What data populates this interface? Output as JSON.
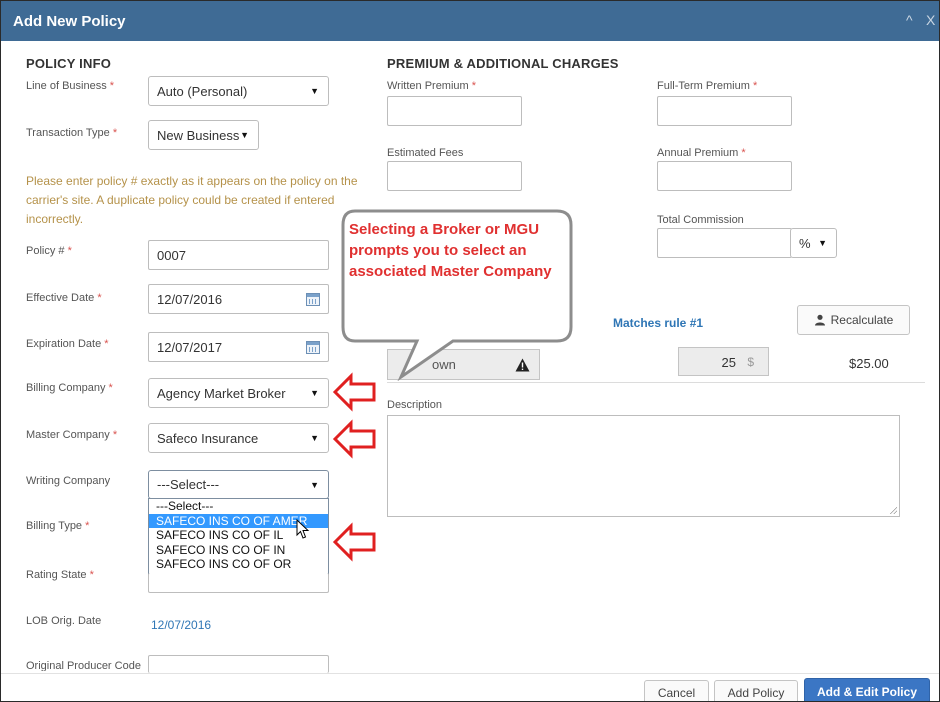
{
  "dialog": {
    "title": "Add New Policy",
    "collapse_glyph": "^",
    "close_glyph": "X"
  },
  "policy_info": {
    "heading": "POLICY INFO",
    "line_of_business": {
      "label": "Line of Business",
      "value": "Auto (Personal)"
    },
    "transaction_type": {
      "label": "Transaction Type",
      "value": "New Business"
    },
    "notice": "Please enter policy # exactly as it appears on the policy on the carrier's site. A duplicate policy could be created if entered incorrectly.",
    "policy_number": {
      "label": "Policy #",
      "value": "0007"
    },
    "effective_date": {
      "label": "Effective Date",
      "value": "12/07/2016"
    },
    "expiration_date": {
      "label": "Expiration Date",
      "value": "12/07/2017"
    },
    "billing_company": {
      "label": "Billing Company",
      "value": "Agency Market Broker"
    },
    "master_company": {
      "label": "Master Company",
      "value": "Safeco Insurance"
    },
    "writing_company": {
      "label": "Writing Company",
      "value": "---Select---",
      "options": [
        "---Select---",
        "SAFECO INS CO OF AMER",
        "SAFECO INS CO OF IL",
        "SAFECO INS CO OF IN",
        "SAFECO INS CO OF OR"
      ]
    },
    "billing_type": {
      "label": "Billing Type"
    },
    "rating_state": {
      "label": "Rating State"
    },
    "lob_orig_date": {
      "label": "LOB Orig. Date",
      "value": "12/07/2016"
    },
    "original_producer_code": {
      "label": "Original Producer Code"
    },
    "required_mark": "*"
  },
  "premium": {
    "heading": "PREMIUM & ADDITIONAL CHARGES",
    "written_premium": {
      "label": "Written Premium"
    },
    "full_term_premium": {
      "label": "Full-Term Premium"
    },
    "estimated_fees": {
      "label": "Estimated Fees"
    },
    "annual_premium": {
      "label": "Annual Premium"
    },
    "total_commission": {
      "label": "Total Commission",
      "unit": "%"
    },
    "matches_rule": "Matches rule #1",
    "recalculate": "Recalculate",
    "unknown_value": "own",
    "rate_value": "25",
    "rate_unit": "$",
    "amount": "$25.00",
    "description": {
      "label": "Description"
    }
  },
  "callout": {
    "text": "Selecting a Broker or MGU prompts you to select an associated Master Company"
  },
  "footer": {
    "cancel": "Cancel",
    "add_policy": "Add Policy",
    "add_edit_policy": "Add & Edit Policy"
  },
  "colors": {
    "titlebar": "#3f6b95",
    "primary_button": "#3b76c4",
    "notice_text": "#b5924a",
    "callout_text": "#e03030",
    "arrow": "#e02020",
    "selection": "#3399ff"
  }
}
